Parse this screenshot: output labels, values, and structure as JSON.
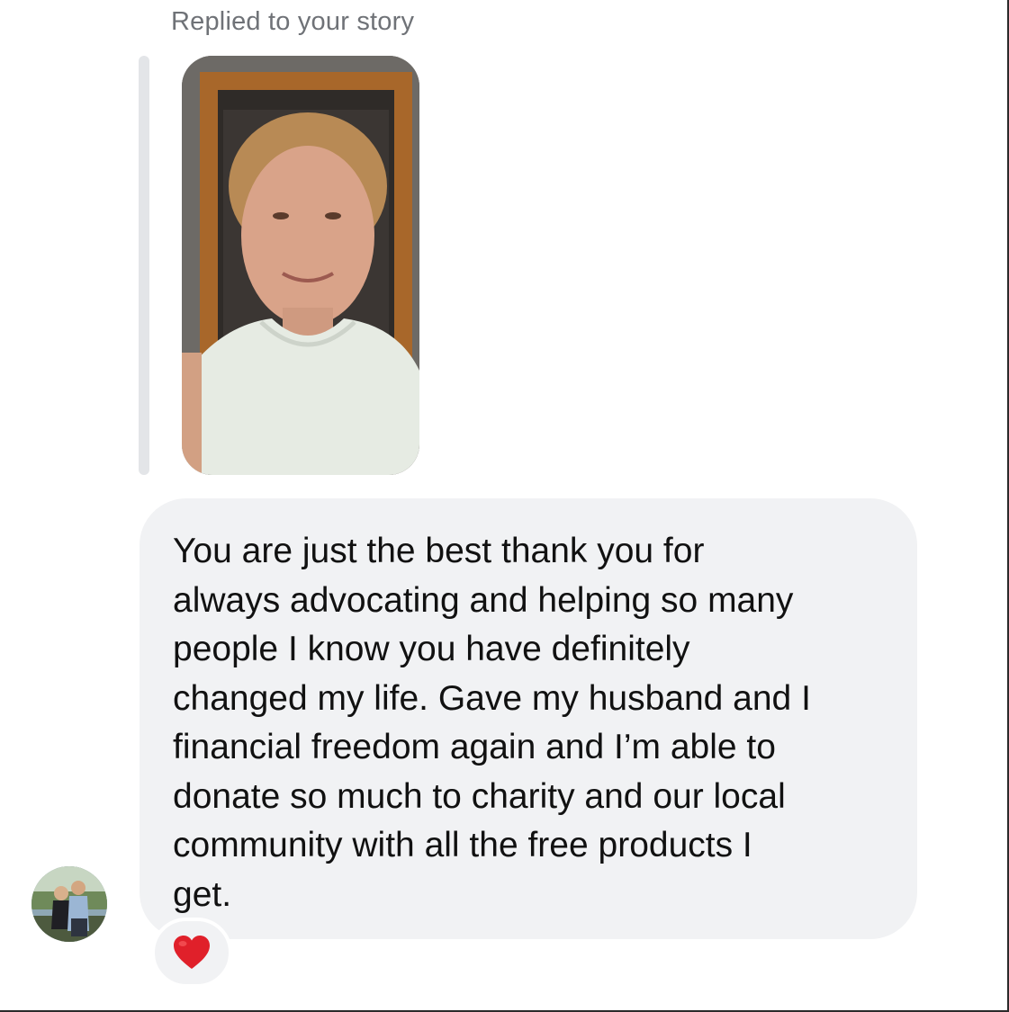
{
  "conversation": {
    "reply_caption": "Replied to your story",
    "message": {
      "text": "You are just the best thank you for\nalways advocating and helping so many\npeople I know you have definitely\nchanged my life. Gave my husband and I\nfinancial freedom again and I’m able to\ndonate so much to charity and our local\ncommunity with all the free products I\nget."
    },
    "reaction": {
      "icon": "red-heart-icon",
      "color": "#e0202a"
    }
  },
  "colors": {
    "bubble": "#f1f2f4",
    "caption": "#6f7277",
    "text": "#111111"
  }
}
